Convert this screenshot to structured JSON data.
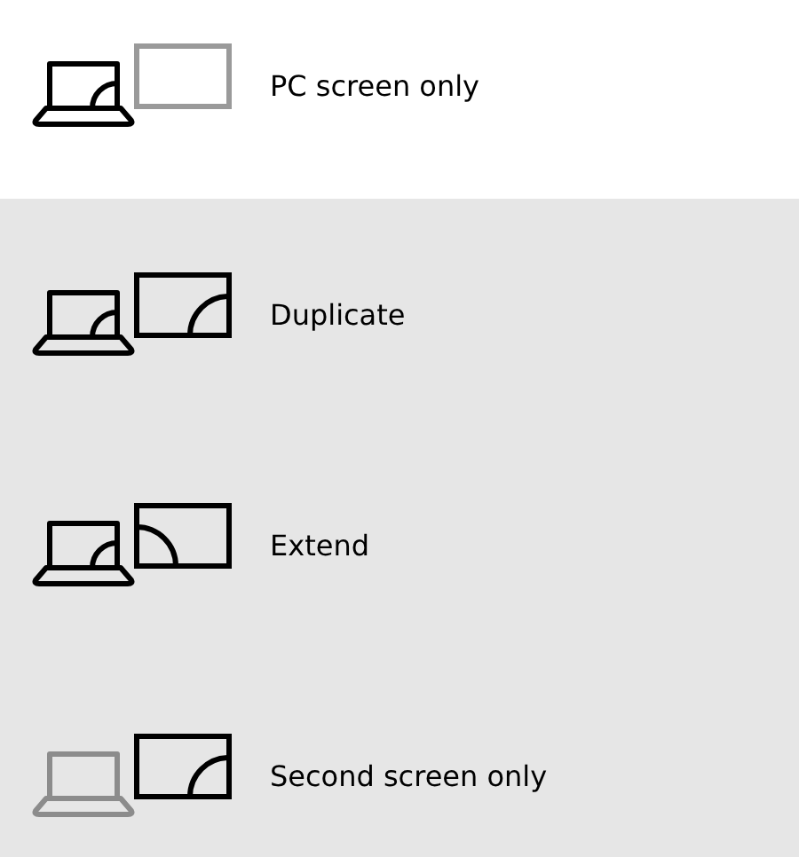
{
  "items": [
    {
      "label": "PC screen only",
      "kind": "pc_only",
      "selected": true
    },
    {
      "label": "Duplicate",
      "kind": "duplicate",
      "selected": false
    },
    {
      "label": "Extend",
      "kind": "extend",
      "selected": false
    },
    {
      "label": "Second screen only",
      "kind": "second_only",
      "selected": false
    }
  ]
}
